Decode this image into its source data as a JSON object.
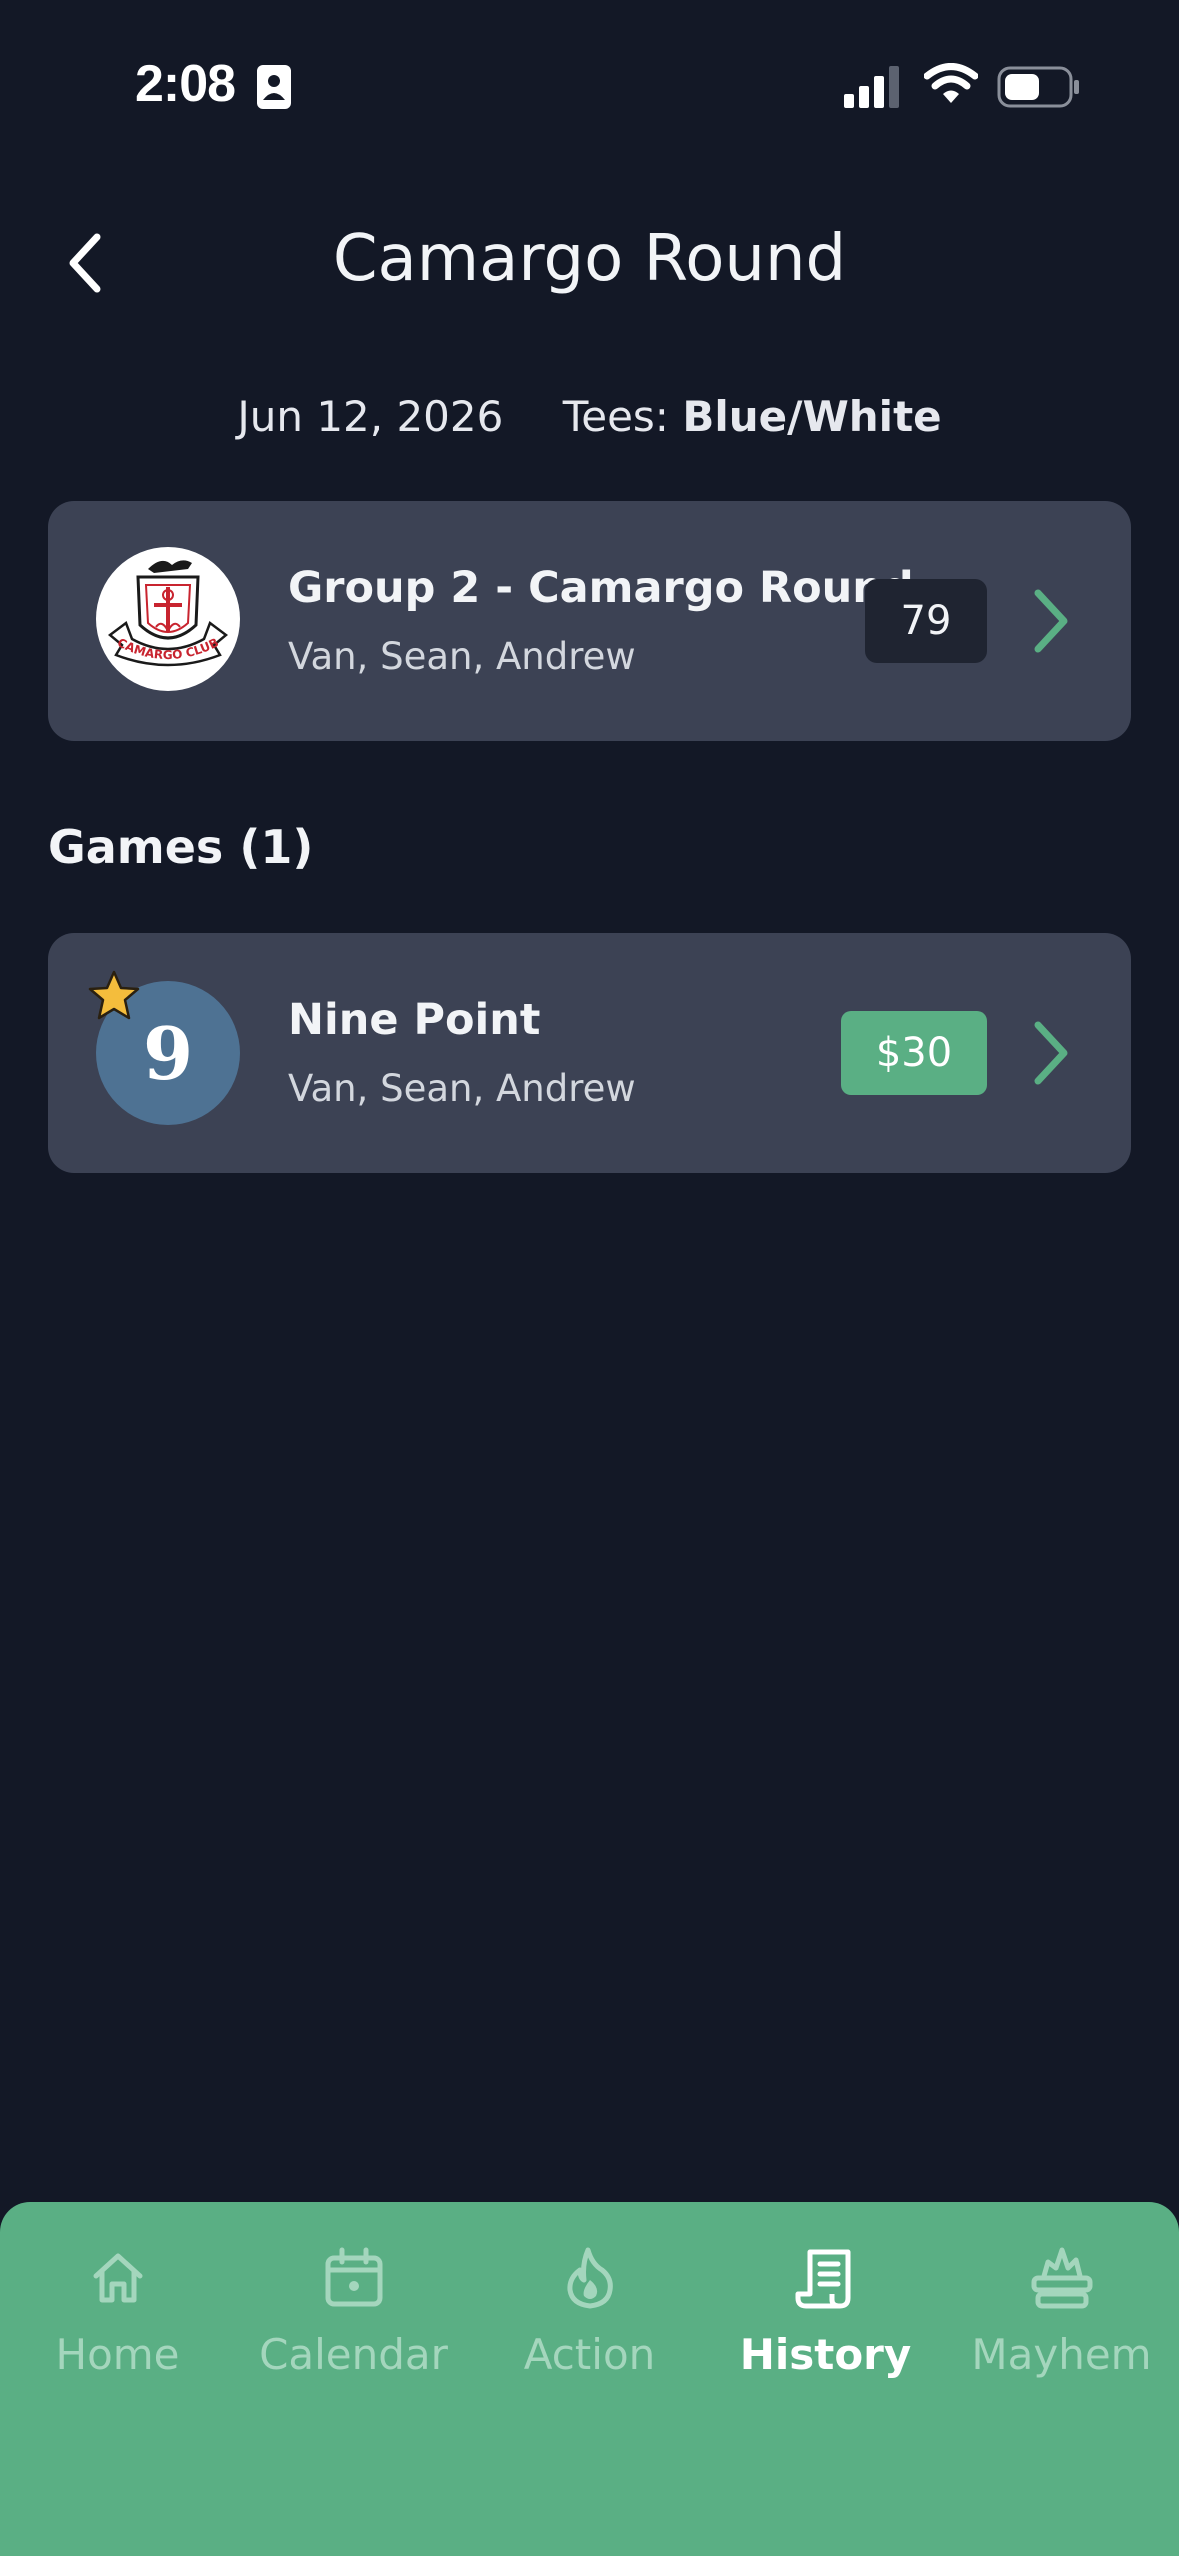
{
  "status_bar": {
    "time": "2:08",
    "icons": [
      "id-card-icon",
      "signal-icon",
      "wifi-icon",
      "battery-icon"
    ]
  },
  "header": {
    "title": "Camargo Round",
    "back_icon": "chevron-left-icon"
  },
  "round_info": {
    "date": "Jun 12, 2026",
    "tees_label": "Tees:",
    "tees_value": "Blue/White"
  },
  "group": {
    "title": "Group 2 - Camargo Round",
    "players": "Van, Sean, Andrew",
    "score": "79",
    "logo_text": "CAMARGO CLUB"
  },
  "games_section": {
    "heading": "Games (1)",
    "games": [
      {
        "avatar_text": "9",
        "title": "Nine Point",
        "players": "Van, Sean, Andrew",
        "amount": "$30",
        "favorite": true
      }
    ]
  },
  "tab_bar": {
    "tabs": [
      {
        "label": "Home",
        "icon": "home-icon",
        "active": false
      },
      {
        "label": "Calendar",
        "icon": "calendar-icon",
        "active": false
      },
      {
        "label": "Action",
        "icon": "flame-icon",
        "active": false
      },
      {
        "label": "History",
        "icon": "receipt-icon",
        "active": true
      },
      {
        "label": "Mayhem",
        "icon": "explosion-icon",
        "active": false
      }
    ]
  },
  "colors": {
    "background": "#131826",
    "card": "#3c4254",
    "accent_green": "#5aaf84",
    "avatar_blue": "#4e7293",
    "star": "#f4bd3c"
  }
}
